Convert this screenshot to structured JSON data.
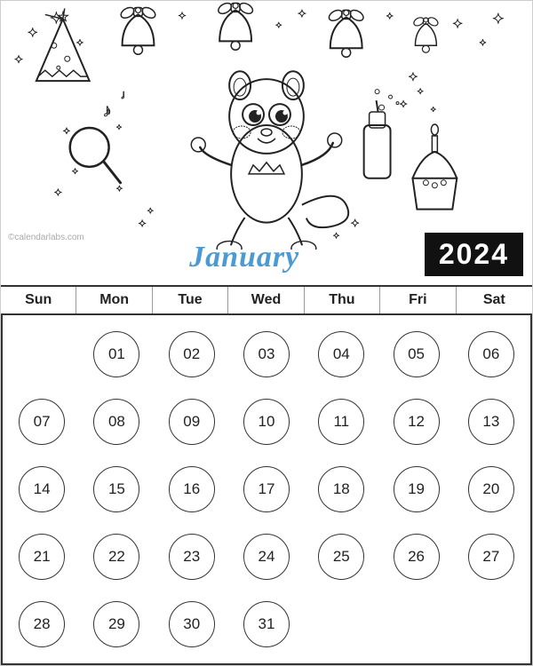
{
  "watermark": "©calendarlabs.com",
  "year": "2024",
  "month": "January",
  "days_of_week": [
    "Sun",
    "Mon",
    "Tue",
    "Wed",
    "Thu",
    "Fri",
    "Sat"
  ],
  "weeks": [
    [
      "",
      "01",
      "02",
      "03",
      "04",
      "05",
      "06"
    ],
    [
      "07",
      "08",
      "09",
      "10",
      "11",
      "12",
      "13"
    ],
    [
      "14",
      "15",
      "16",
      "17",
      "18",
      "19",
      "20"
    ],
    [
      "21",
      "22",
      "23",
      "24",
      "25",
      "26",
      "27"
    ],
    [
      "28",
      "29",
      "30",
      "31",
      "",
      "",
      ""
    ]
  ]
}
